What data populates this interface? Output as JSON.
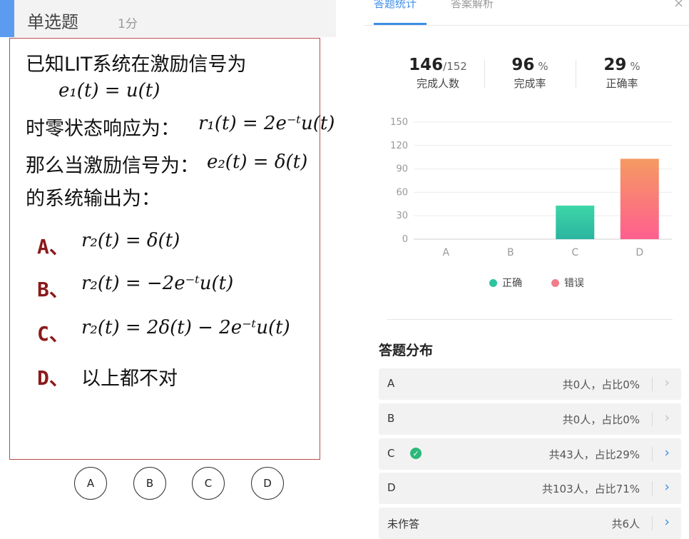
{
  "question": {
    "type_label": "单选题",
    "score_label": "1分",
    "stem_line1": "已知LIT系统在激励信号为",
    "stem_line2": "时零状态响应为：",
    "stem_line3": "那么当激励信号为：",
    "stem_line4": "的系统输出为：",
    "math_e1": "e₁(t) = u(t)",
    "math_r1": "r₁(t) = 2e⁻ᵗu(t)",
    "math_e2": "e₂(t) = δ(t)",
    "options": [
      {
        "letter": "A、",
        "text": "r₂(t) = δ(t)"
      },
      {
        "letter": "B、",
        "text": "r₂(t) = −2e⁻ᵗu(t)"
      },
      {
        "letter": "C、",
        "text": "r₂(t) = 2δ(t) − 2e⁻ᵗu(t)"
      },
      {
        "letter": "D、",
        "text": "以上都不对"
      }
    ],
    "answer_buttons": [
      "A",
      "B",
      "C",
      "D"
    ]
  },
  "tabs": {
    "stats": "答题统计",
    "analysis": "答案解析",
    "close": "×"
  },
  "stats": {
    "completed": "146",
    "total": "/152",
    "completed_label": "完成人数",
    "completion_rate": "96",
    "completion_unit": "%",
    "completion_label": "完成率",
    "correct_rate": "29",
    "correct_unit": "%",
    "correct_label": "正确率"
  },
  "legend": {
    "correct": "正确",
    "wrong": "错误",
    "correct_color": "#2ec4a0",
    "wrong_color": "#f07e8a"
  },
  "chart_data": {
    "type": "bar",
    "categories": [
      "A",
      "B",
      "C",
      "D"
    ],
    "values": [
      0,
      0,
      43,
      103
    ],
    "correct_category": "C",
    "ylim": [
      0,
      150
    ],
    "yticks": [
      0,
      30,
      60,
      90,
      120,
      150
    ],
    "grid": true,
    "legend_position": "bottom"
  },
  "distribution": {
    "title": "答题分布",
    "rows": [
      {
        "name": "A",
        "info": "共0人，占比0%",
        "correct": false,
        "active": false
      },
      {
        "name": "B",
        "info": "共0人，占比0%",
        "correct": false,
        "active": false
      },
      {
        "name": "C",
        "info": "共43人，占比29%",
        "correct": true,
        "active": true
      },
      {
        "name": "D",
        "info": "共103人，占比71%",
        "correct": false,
        "active": true
      },
      {
        "name": "未作答",
        "info": "共6人",
        "correct": false,
        "active": true
      }
    ]
  }
}
